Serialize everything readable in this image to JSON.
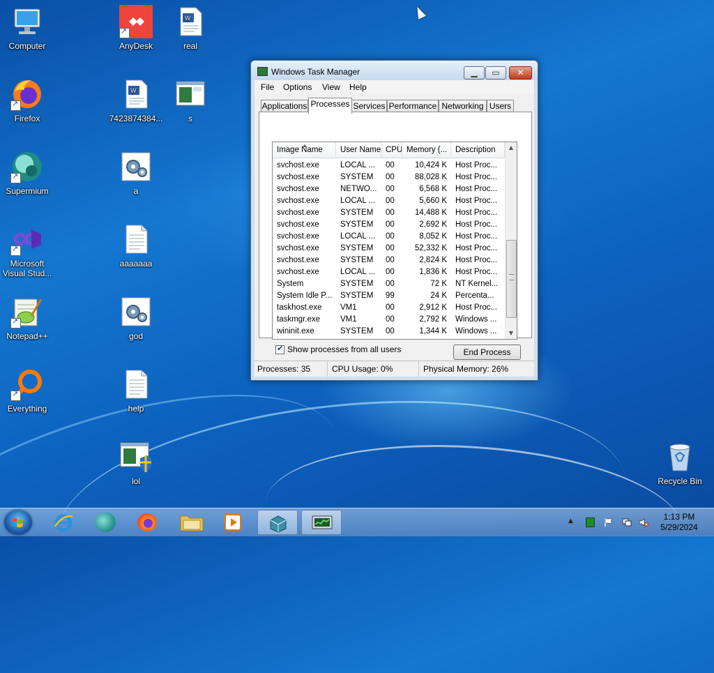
{
  "desktop": {
    "icons": [
      {
        "name": "desktop-icon-computer",
        "label": "Computer",
        "icon": "computer-icon"
      },
      {
        "name": "desktop-icon-anydesk",
        "label": "AnyDesk",
        "icon": "anydesk-icon"
      },
      {
        "name": "desktop-icon-real",
        "label": "real",
        "icon": "word-document-icon"
      },
      {
        "name": "desktop-icon-firefox",
        "label": "Firefox",
        "icon": "firefox-icon"
      },
      {
        "name": "desktop-icon-7423874384",
        "label": "7423874384...",
        "icon": "word-document-icon"
      },
      {
        "name": "desktop-icon-s",
        "label": "s",
        "icon": "window-image-icon"
      },
      {
        "name": "desktop-icon-supermium",
        "label": "Supermium",
        "icon": "supermium-icon"
      },
      {
        "name": "desktop-icon-a",
        "label": "a",
        "icon": "settings-file-icon"
      },
      {
        "name": "desktop-icon-visual-studio",
        "label": "Microsoft Visual Stud...",
        "icon": "visual-studio-icon"
      },
      {
        "name": "desktop-icon-aaaaaaa",
        "label": "aaaaaaa",
        "icon": "text-file-icon"
      },
      {
        "name": "desktop-icon-notepadpp",
        "label": "Notepad++",
        "icon": "notepadpp-icon"
      },
      {
        "name": "desktop-icon-god",
        "label": "god",
        "icon": "settings-file-icon"
      },
      {
        "name": "desktop-icon-everything",
        "label": "Everything",
        "icon": "everything-search-icon"
      },
      {
        "name": "desktop-icon-help",
        "label": "help",
        "icon": "text-file-icon"
      },
      {
        "name": "desktop-icon-lol",
        "label": "lol",
        "icon": "shield-window-icon"
      },
      {
        "name": "desktop-icon-recycle-bin",
        "label": "Recycle Bin",
        "icon": "recycle-bin-icon"
      }
    ]
  },
  "task_manager": {
    "title": "Windows Task Manager",
    "menu": [
      "File",
      "Options",
      "View",
      "Help"
    ],
    "tabs": [
      "Applications",
      "Processes",
      "Services",
      "Performance",
      "Networking",
      "Users"
    ],
    "active_tab": "Processes",
    "columns": [
      "Image Name",
      "User Name",
      "CPU",
      "Memory (...",
      "Description"
    ],
    "rows": [
      [
        "svchost.exe",
        "LOCAL ...",
        "00",
        "10,424 K",
        "Host Proc..."
      ],
      [
        "svchost.exe",
        "SYSTEM",
        "00",
        "88,028 K",
        "Host Proc..."
      ],
      [
        "svchost.exe",
        "NETWO...",
        "00",
        "6,568 K",
        "Host Proc..."
      ],
      [
        "svchost.exe",
        "LOCAL ...",
        "00",
        "5,660 K",
        "Host Proc..."
      ],
      [
        "svchost.exe",
        "SYSTEM",
        "00",
        "14,488 K",
        "Host Proc..."
      ],
      [
        "svchost.exe",
        "SYSTEM",
        "00",
        "2,692 K",
        "Host Proc..."
      ],
      [
        "svchost.exe",
        "LOCAL ...",
        "00",
        "8,052 K",
        "Host Proc..."
      ],
      [
        "svchost.exe",
        "SYSTEM",
        "00",
        "52,332 K",
        "Host Proc..."
      ],
      [
        "svchost.exe",
        "SYSTEM",
        "00",
        "2,824 K",
        "Host Proc..."
      ],
      [
        "svchost.exe",
        "LOCAL ...",
        "00",
        "1,836 K",
        "Host Proc..."
      ],
      [
        "System",
        "SYSTEM",
        "00",
        "72 K",
        "NT Kernel..."
      ],
      [
        "System Idle P...",
        "SYSTEM",
        "99",
        "24 K",
        "Percenta..."
      ],
      [
        "taskhost.exe",
        "VM1",
        "00",
        "2,912 K",
        "Host Proc..."
      ],
      [
        "taskmgr.exe",
        "VM1",
        "00",
        "2,792 K",
        "Windows ..."
      ],
      [
        "wininit.exe",
        "SYSTEM",
        "00",
        "1,344 K",
        "Windows ..."
      ]
    ],
    "show_all_label": "Show processes from all users",
    "show_all_checked": true,
    "end_process_label": "End Process",
    "status": {
      "processes": "Processes: 35",
      "cpu": "CPU Usage: 0%",
      "memory": "Physical Memory: 26%"
    }
  },
  "taskbar": {
    "pinned": [
      "internet-explorer-icon",
      "supermium-icon",
      "firefox-icon",
      "file-explorer-icon",
      "media-player-icon",
      "task-scheduler-icon",
      "task-manager-icon"
    ],
    "clock_time": "1:13 PM",
    "clock_date": "5/29/2024"
  }
}
